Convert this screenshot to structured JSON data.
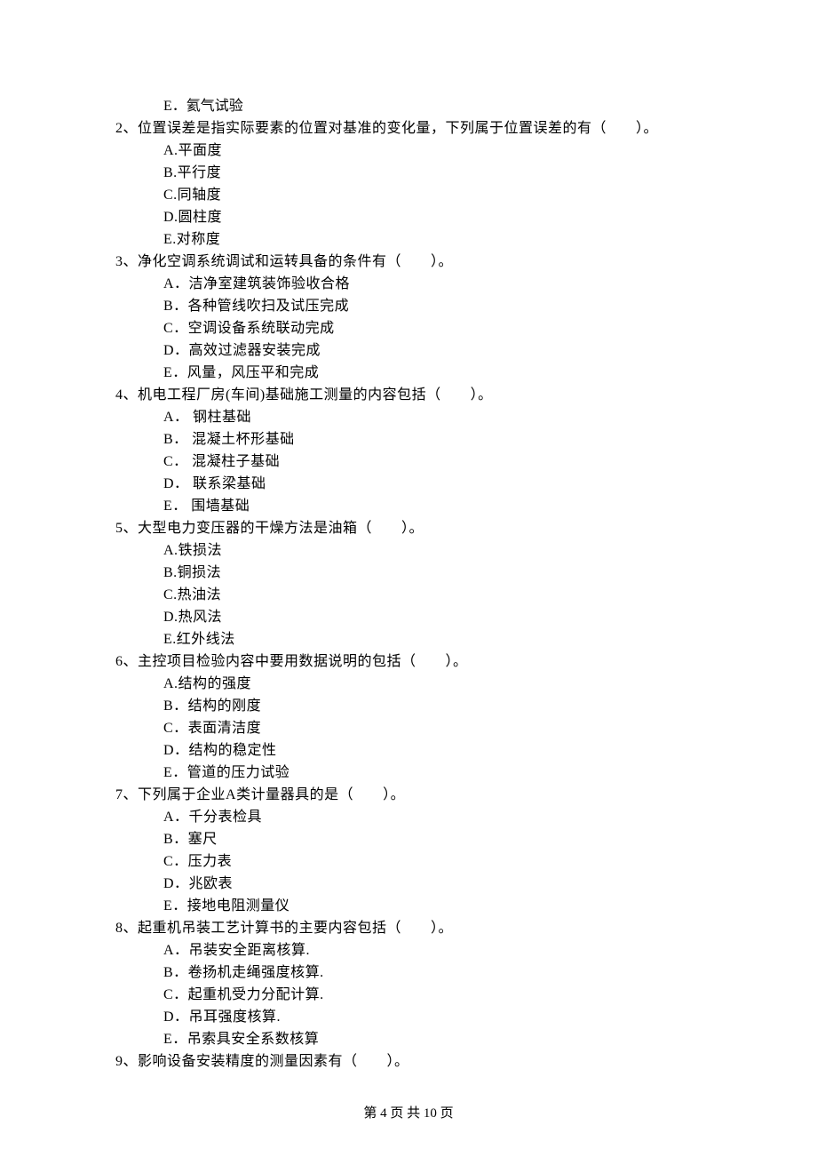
{
  "preOption": "E．氦气试验",
  "questions": [
    {
      "num": "2、",
      "text": "位置误差是指实际要素的位置对基准的变化量，下列属于位置误差的有（　　）。",
      "options": [
        "A.平面度",
        "B.平行度",
        "C.同轴度",
        "D.圆柱度",
        "E.对称度"
      ]
    },
    {
      "num": "3、",
      "text": "净化空调系统调试和运转具备的条件有（　　）。",
      "options": [
        "A．洁净室建筑装饰验收合格",
        "B．各种管线吹扫及试压完成",
        "C．空调设备系统联动完成",
        "D．高效过滤器安装完成",
        "E．风量，风压平和完成"
      ]
    },
    {
      "num": "4、",
      "text": "机电工程厂房(车间)基础施工测量的内容包括（　　）。",
      "options": [
        "A． 钢柱基础",
        "B． 混凝土杯形基础",
        "C． 混凝柱子基础",
        "D． 联系梁基础",
        "E． 围墙基础"
      ]
    },
    {
      "num": "5、",
      "text": "大型电力变压器的干燥方法是油箱（　　）。",
      "options": [
        "A.铁损法",
        "B.铜损法",
        "C.热油法",
        "D.热风法",
        "E.红外线法"
      ]
    },
    {
      "num": "6、",
      "text": "主控项目检验内容中要用数据说明的包括（　　）。",
      "options": [
        "A.结构的强度",
        "B．结构的刚度",
        "C．表面清洁度",
        "D．结构的稳定性",
        "E．管道的压力试验"
      ]
    },
    {
      "num": "7、",
      "text": "下列属于企业A类计量器具的是（　　）。",
      "options": [
        "A．千分表检具",
        "B．塞尺",
        "C．压力表",
        "D．兆欧表",
        "E．接地电阻测量仪"
      ]
    },
    {
      "num": "8、",
      "text": "起重机吊装工艺计算书的主要内容包括（　　）。",
      "options": [
        "A．吊装安全距离核算.",
        "B．卷扬机走绳强度核算.",
        "C．起重机受力分配计算.",
        "D．吊耳强度核算.",
        "E．吊索具安全系数核算"
      ]
    },
    {
      "num": "9、",
      "text": "影响设备安装精度的测量因素有（　　）。",
      "options": []
    }
  ],
  "footer": "第 4 页 共 10 页"
}
